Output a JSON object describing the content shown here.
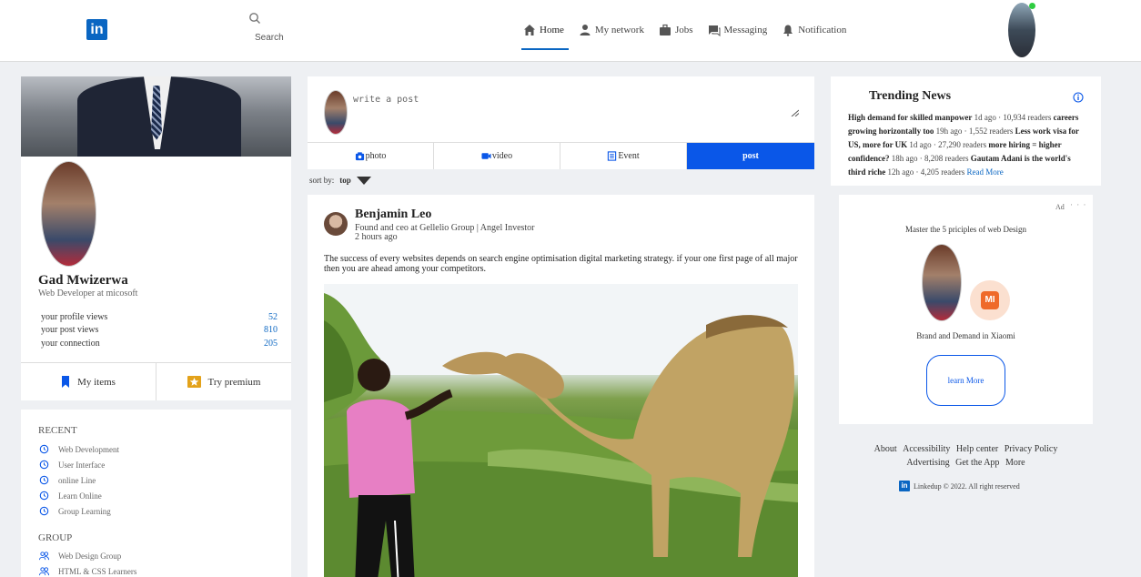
{
  "nav": {
    "logo": "in",
    "search_label": "Search",
    "items": [
      {
        "label": "Home",
        "icon": "home-icon"
      },
      {
        "label": "My network",
        "icon": "person-icon"
      },
      {
        "label": "Jobs",
        "icon": "briefcase-icon"
      },
      {
        "label": "Messaging",
        "icon": "chat-icon"
      },
      {
        "label": "Notification",
        "icon": "bell-icon"
      }
    ],
    "active": "Home"
  },
  "profile": {
    "name": "Gad Mwizerwa",
    "headline": "Web Developer at micosoft",
    "stats": [
      {
        "label": "your profile views",
        "value": "52"
      },
      {
        "label": "your post views",
        "value": "810"
      },
      {
        "label": "your connection",
        "value": "205"
      }
    ],
    "actions": [
      {
        "label": "My items",
        "icon": "bookmark-icon"
      },
      {
        "label": "Try premium",
        "icon": "star-icon"
      }
    ]
  },
  "recent": {
    "heading": "RECENT",
    "items": [
      "Web Development",
      "User Interface",
      "online Line",
      "Learn Online",
      "Group Learning"
    ],
    "group_heading": "GROUP",
    "groups": [
      "Web Design Group",
      "HTML & CSS Learners"
    ]
  },
  "composer": {
    "placeholder": "write a post",
    "actions": [
      {
        "label": "photo",
        "icon": "camera-icon"
      },
      {
        "label": "video",
        "icon": "video-icon"
      },
      {
        "label": "Event",
        "icon": "calendar-icon"
      }
    ],
    "post_label": "post"
  },
  "sort": {
    "label": "sort by:",
    "value": "top"
  },
  "post": {
    "author": "Benjamin Leo",
    "subtitle": "Found and ceo at Gellelio Group | Angel Investor",
    "time": "2 hours ago",
    "text": "The success of every websites depends on search engine optimisation digital marketing strategy. if your one first page of all major then you are ahead among your competitors."
  },
  "news": {
    "title": "Trending News",
    "items": [
      {
        "headline": "High demand for skilled manpower",
        "meta": "1d ago · 10,934 readers"
      },
      {
        "headline": "careers growing horizontally too",
        "meta": "19h ago · 1,552 readers"
      },
      {
        "headline": "Less work visa for US, more for UK",
        "meta": "1d ago · 27,290 readers"
      },
      {
        "headline": "more hiring = higher confidence?",
        "meta": "18h ago · 8,208 readers"
      },
      {
        "headline": "Gautam Adani is the world's third riche",
        "meta": "12h ago · 4,205 readers"
      }
    ],
    "read_more": "Read More"
  },
  "ad": {
    "label": "Ad",
    "dots": "· · ·",
    "title": "Master the 5 priciples of web Design",
    "brand_logo": "MI",
    "subtitle": "Brand and Demand in Xiaomi",
    "button": "learn More"
  },
  "footer": {
    "row1": [
      "About",
      "Accessibility",
      "Help center",
      "Privacy Policy"
    ],
    "row2": [
      "Advertising",
      "Get the App",
      "More"
    ],
    "copyright": "Linkedup © 2022. All right reserved"
  }
}
